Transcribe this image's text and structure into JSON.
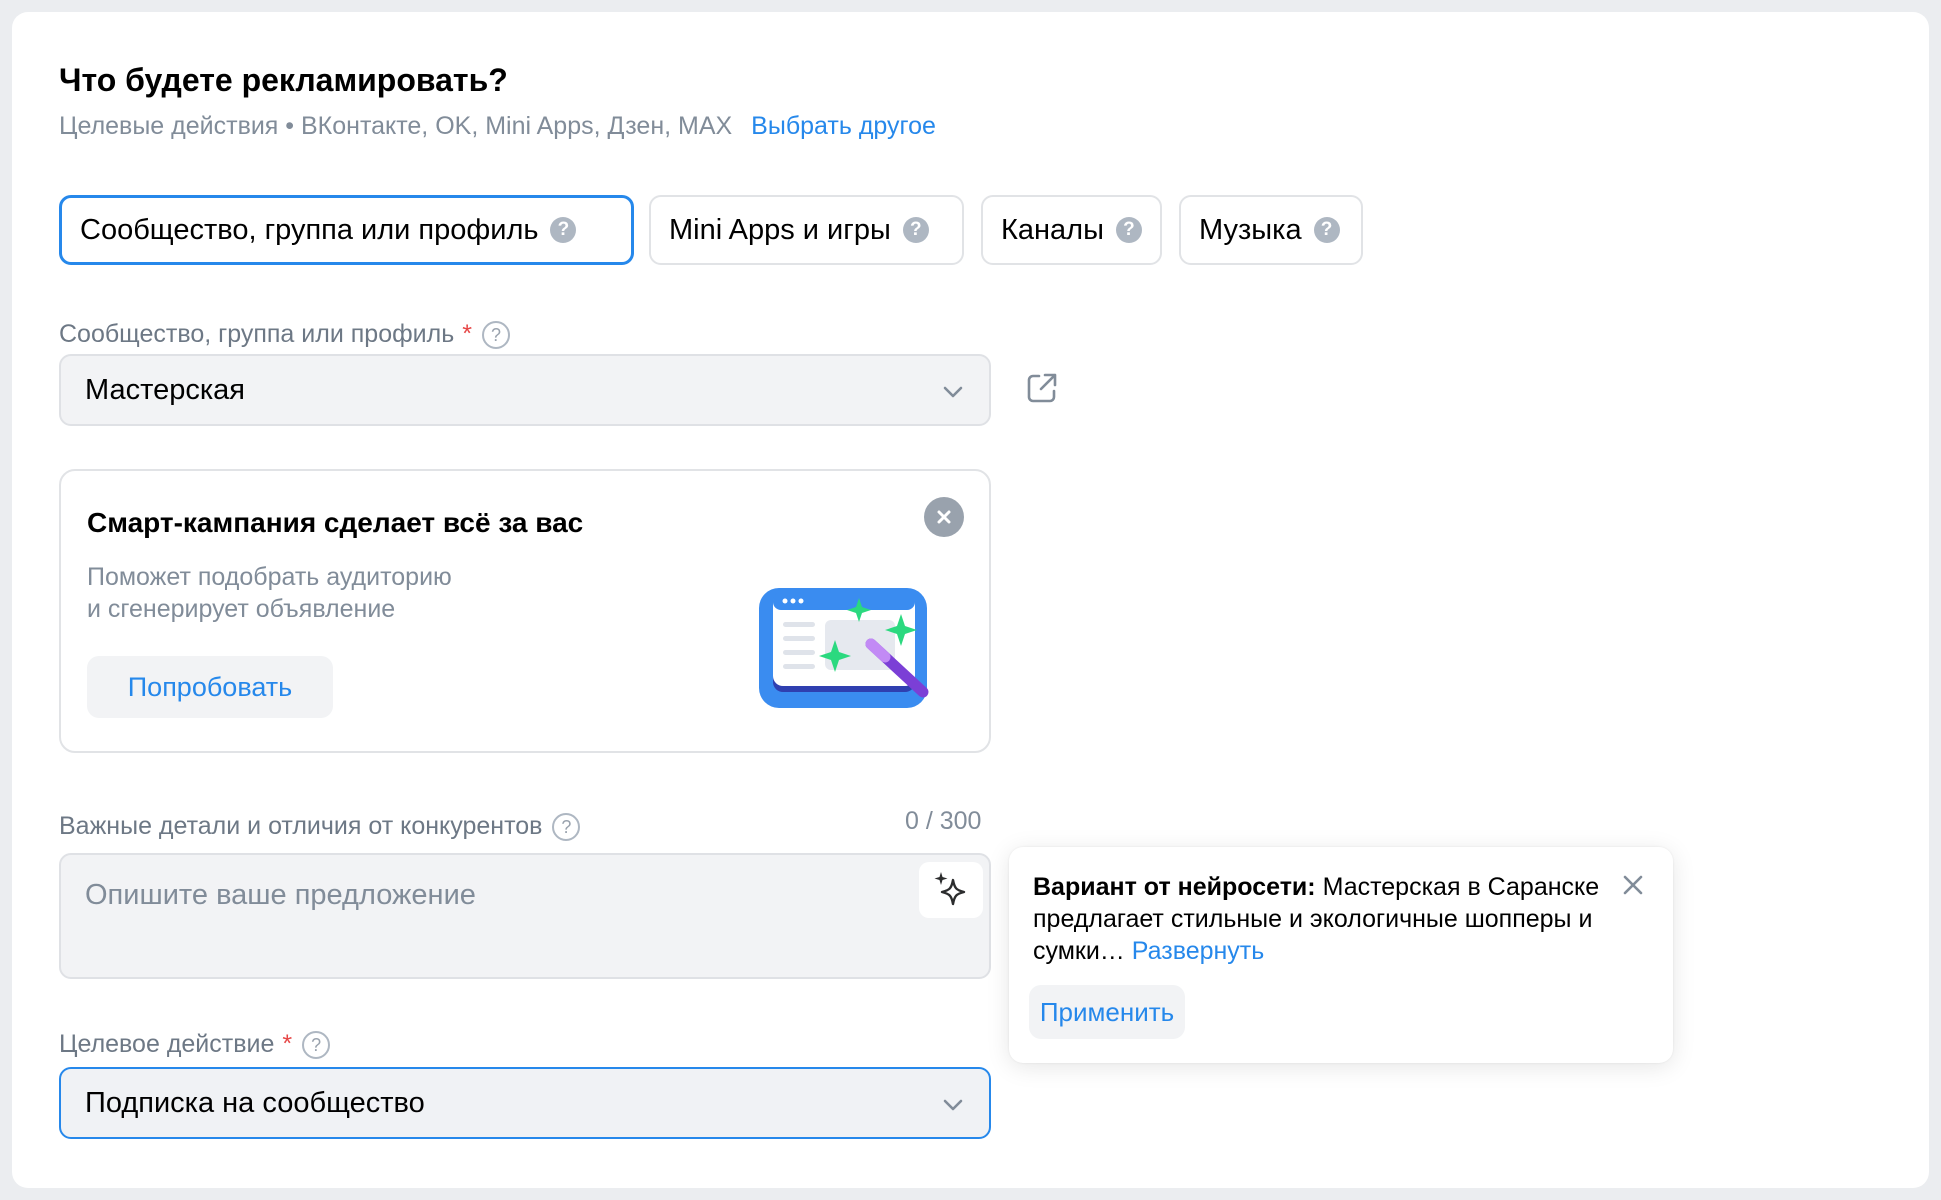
{
  "header": {
    "title": "Что будете рекламировать?",
    "subtitle": "Целевые действия • ВКонтакте, OK, Mini Apps, Дзен, MAX",
    "subtitle_link": "Выбрать другое"
  },
  "tabs": [
    {
      "label": "Сообщество, группа или профиль",
      "active": true
    },
    {
      "label": "Mini Apps и игры",
      "active": false
    },
    {
      "label": "Каналы",
      "active": false
    },
    {
      "label": "Музыка",
      "active": false
    }
  ],
  "community_field": {
    "label": "Сообщество, группа или профиль",
    "required_mark": "*",
    "value": "Мастерская"
  },
  "promo": {
    "title": "Смарт-кампания сделает всё за вас",
    "text_line1": "Поможет подобрать аудиторию",
    "text_line2": "и сгенерирует объявление",
    "button": "Попробовать"
  },
  "details_field": {
    "label": "Важные детали и отличия от конкурентов",
    "counter": "0 / 300",
    "placeholder": "Опишите ваше предложение"
  },
  "ai_popup": {
    "prefix": "Вариант от нейросети:",
    "text": " Мастерская в Саранске предлагает стильные и экологичные шопперы и сумки… ",
    "expand_link": "Развернуть",
    "apply_button": "Применить"
  },
  "target_action_field": {
    "label": "Целевое действие",
    "required_mark": "*",
    "value": "Подписка на сообщество"
  },
  "colors": {
    "accent": "#2688eb",
    "secondary_text": "#818c99",
    "required": "#e64646"
  },
  "icons": {
    "help": "question-circle-icon",
    "external": "external-link-icon",
    "chevron": "chevron-down-icon",
    "close": "close-icon",
    "sparkle": "sparkle-icon"
  }
}
